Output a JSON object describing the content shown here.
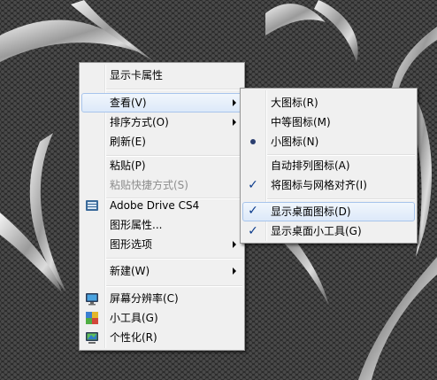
{
  "context_menu": {
    "items": [
      {
        "label": "显示卡属性"
      },
      {
        "label": "查看(V)"
      },
      {
        "label": "排序方式(O)"
      },
      {
        "label": "刷新(E)"
      },
      {
        "label": "粘贴(P)"
      },
      {
        "label": "粘贴快捷方式(S)"
      },
      {
        "label": "Adobe Drive CS4",
        "icon": "adobe-drive-icon"
      },
      {
        "label": "图形属性..."
      },
      {
        "label": "图形选项"
      },
      {
        "label": "新建(W)"
      },
      {
        "label": "屏幕分辨率(C)",
        "icon": "monitor-icon"
      },
      {
        "label": "小工具(G)",
        "icon": "gadgets-icon"
      },
      {
        "label": "个性化(R)",
        "icon": "personalize-icon"
      }
    ]
  },
  "view_submenu": {
    "items": [
      {
        "label": "大图标(R)"
      },
      {
        "label": "中等图标(M)"
      },
      {
        "label": "小图标(N)",
        "selected": true
      },
      {
        "label": "自动排列图标(A)"
      },
      {
        "label": "将图标与网格对齐(I)",
        "checked": true
      },
      {
        "label": "显示桌面图标(D)",
        "checked": true
      },
      {
        "label": "显示桌面小工具(G)",
        "checked": true
      }
    ]
  },
  "glyphs": {
    "check": "✓"
  }
}
